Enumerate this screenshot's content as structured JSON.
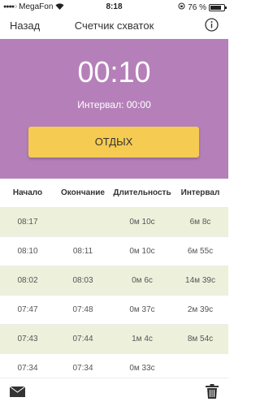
{
  "status_bar": {
    "carrier": "MegaFon",
    "time": "8:18",
    "battery": "76 %",
    "icons": [
      "signal-icon",
      "wifi-icon",
      "lock-rotation-icon",
      "battery-icon"
    ]
  },
  "nav": {
    "back_label": "Назад",
    "title": "Счетчик схваток",
    "info_icon": "info-icon"
  },
  "timer": {
    "value": "00:10",
    "interval_label": "Интервал: 00:00",
    "button_label": "ОТДЫХ"
  },
  "colors": {
    "panel": "#b580b9",
    "button": "#f6cb52",
    "row_alt": "#edf1dc"
  },
  "table": {
    "headers": [
      "Начало",
      "Окончание",
      "Длительность",
      "Интервал"
    ],
    "rows": [
      {
        "start": "08:17",
        "end": "",
        "duration": "0м 10с",
        "interval": "6м 8с"
      },
      {
        "start": "08:10",
        "end": "08:11",
        "duration": "0м 10с",
        "interval": "6м 55с"
      },
      {
        "start": "08:02",
        "end": "08:03",
        "duration": "0м 6с",
        "interval": "14м 39с"
      },
      {
        "start": "07:47",
        "end": "07:48",
        "duration": "0м 37с",
        "interval": "2м 39с"
      },
      {
        "start": "07:43",
        "end": "07:44",
        "duration": "1м 4с",
        "interval": "8м 54с"
      },
      {
        "start": "07:34",
        "end": "07:34",
        "duration": "0м 33с",
        "interval": ""
      }
    ]
  },
  "bottom_bar": {
    "icons": [
      "mail-icon",
      "trash-icon"
    ]
  }
}
